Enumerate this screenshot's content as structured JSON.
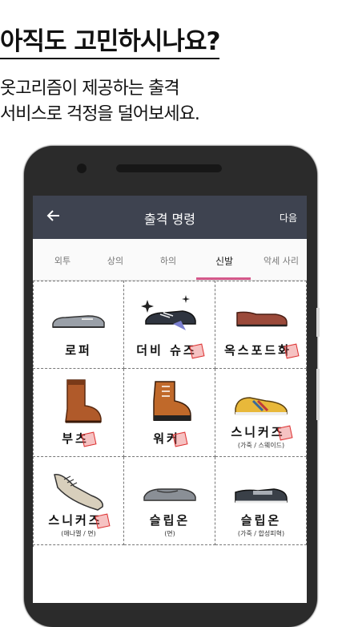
{
  "promo": {
    "title": "아직도 고민하시나요?",
    "line1": "옷고리즘이 제공하는 출격",
    "line2": "서비스로 걱정을 덜어보세요."
  },
  "appbar": {
    "title": "출격 명령",
    "next_label": "다음"
  },
  "tabs": [
    {
      "label": "외투"
    },
    {
      "label": "상의"
    },
    {
      "label": "하의"
    },
    {
      "label": "신발",
      "active": true
    },
    {
      "label": "악세 사리"
    }
  ],
  "items": [
    {
      "label": "로퍼",
      "sub": "",
      "icon": "loafer-icon"
    },
    {
      "label": "더비 슈즈",
      "sub": "",
      "icon": "derby-shoes-icon"
    },
    {
      "label": "옥스포드화",
      "sub": "",
      "icon": "oxford-shoes-icon"
    },
    {
      "label": "부츠",
      "sub": "",
      "icon": "boots-icon"
    },
    {
      "label": "워커",
      "sub": "",
      "icon": "walker-boots-icon"
    },
    {
      "label": "스니커즈",
      "sub": "(가죽 / 스웨이드)",
      "icon": "leather-sneaker-icon"
    },
    {
      "label": "스니커즈",
      "sub": "(애나멜 / 면)",
      "icon": "canvas-sneaker-icon"
    },
    {
      "label": "슬립온",
      "sub": "(면)",
      "icon": "slip-on-icon"
    },
    {
      "label": "슬립온",
      "sub": "(가죽 / 합성피혁)",
      "icon": "leather-slip-on-icon"
    }
  ]
}
